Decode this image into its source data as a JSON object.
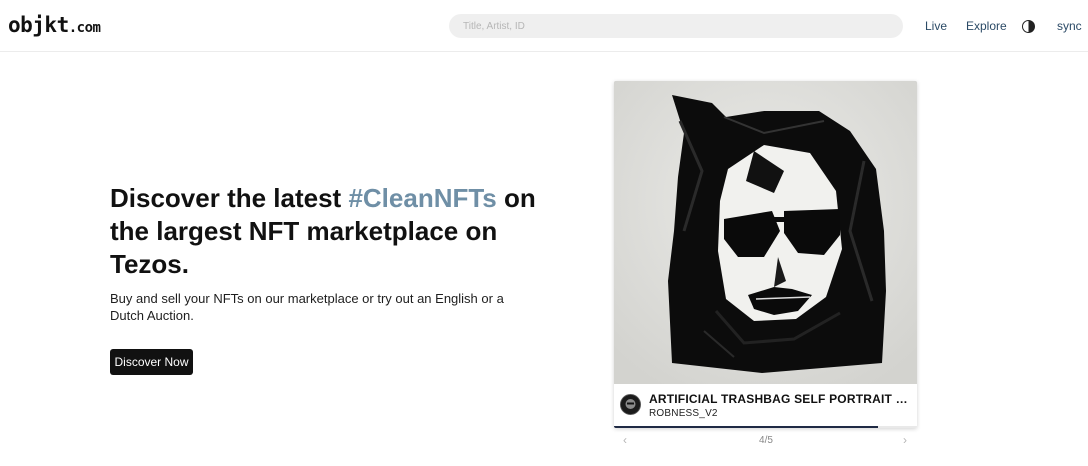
{
  "header": {
    "logo_main": "objkt",
    "logo_domain": ".com",
    "search_placeholder": "Title, Artist, ID",
    "nav": {
      "live": "Live",
      "explore": "Explore",
      "sync": "sync"
    },
    "theme_toggle_icon": "half-moon-icon"
  },
  "hero": {
    "title_before": "Discover the latest ",
    "title_accent": "#CleanNFTs",
    "title_after": " on the largest NFT marketplace on Tezos.",
    "subtitle": "Buy and sell your NFTs on our marketplace or try out an English or a Dutch Auction.",
    "cta_label": "Discover Now"
  },
  "featured": {
    "title": "ARTIFICIAL TRASHBAG SELF PORTRAIT OF…",
    "artist": "ROBNESS_V2",
    "progress": 0.87,
    "counter": "4/5",
    "prev_icon": "chevron-left-icon",
    "next_icon": "chevron-right-icon"
  },
  "colors": {
    "accent": "#6f8fa6",
    "nav_link": "#2b4a66",
    "cta_bg": "#111111",
    "progress_fill": "#1f2a44"
  }
}
